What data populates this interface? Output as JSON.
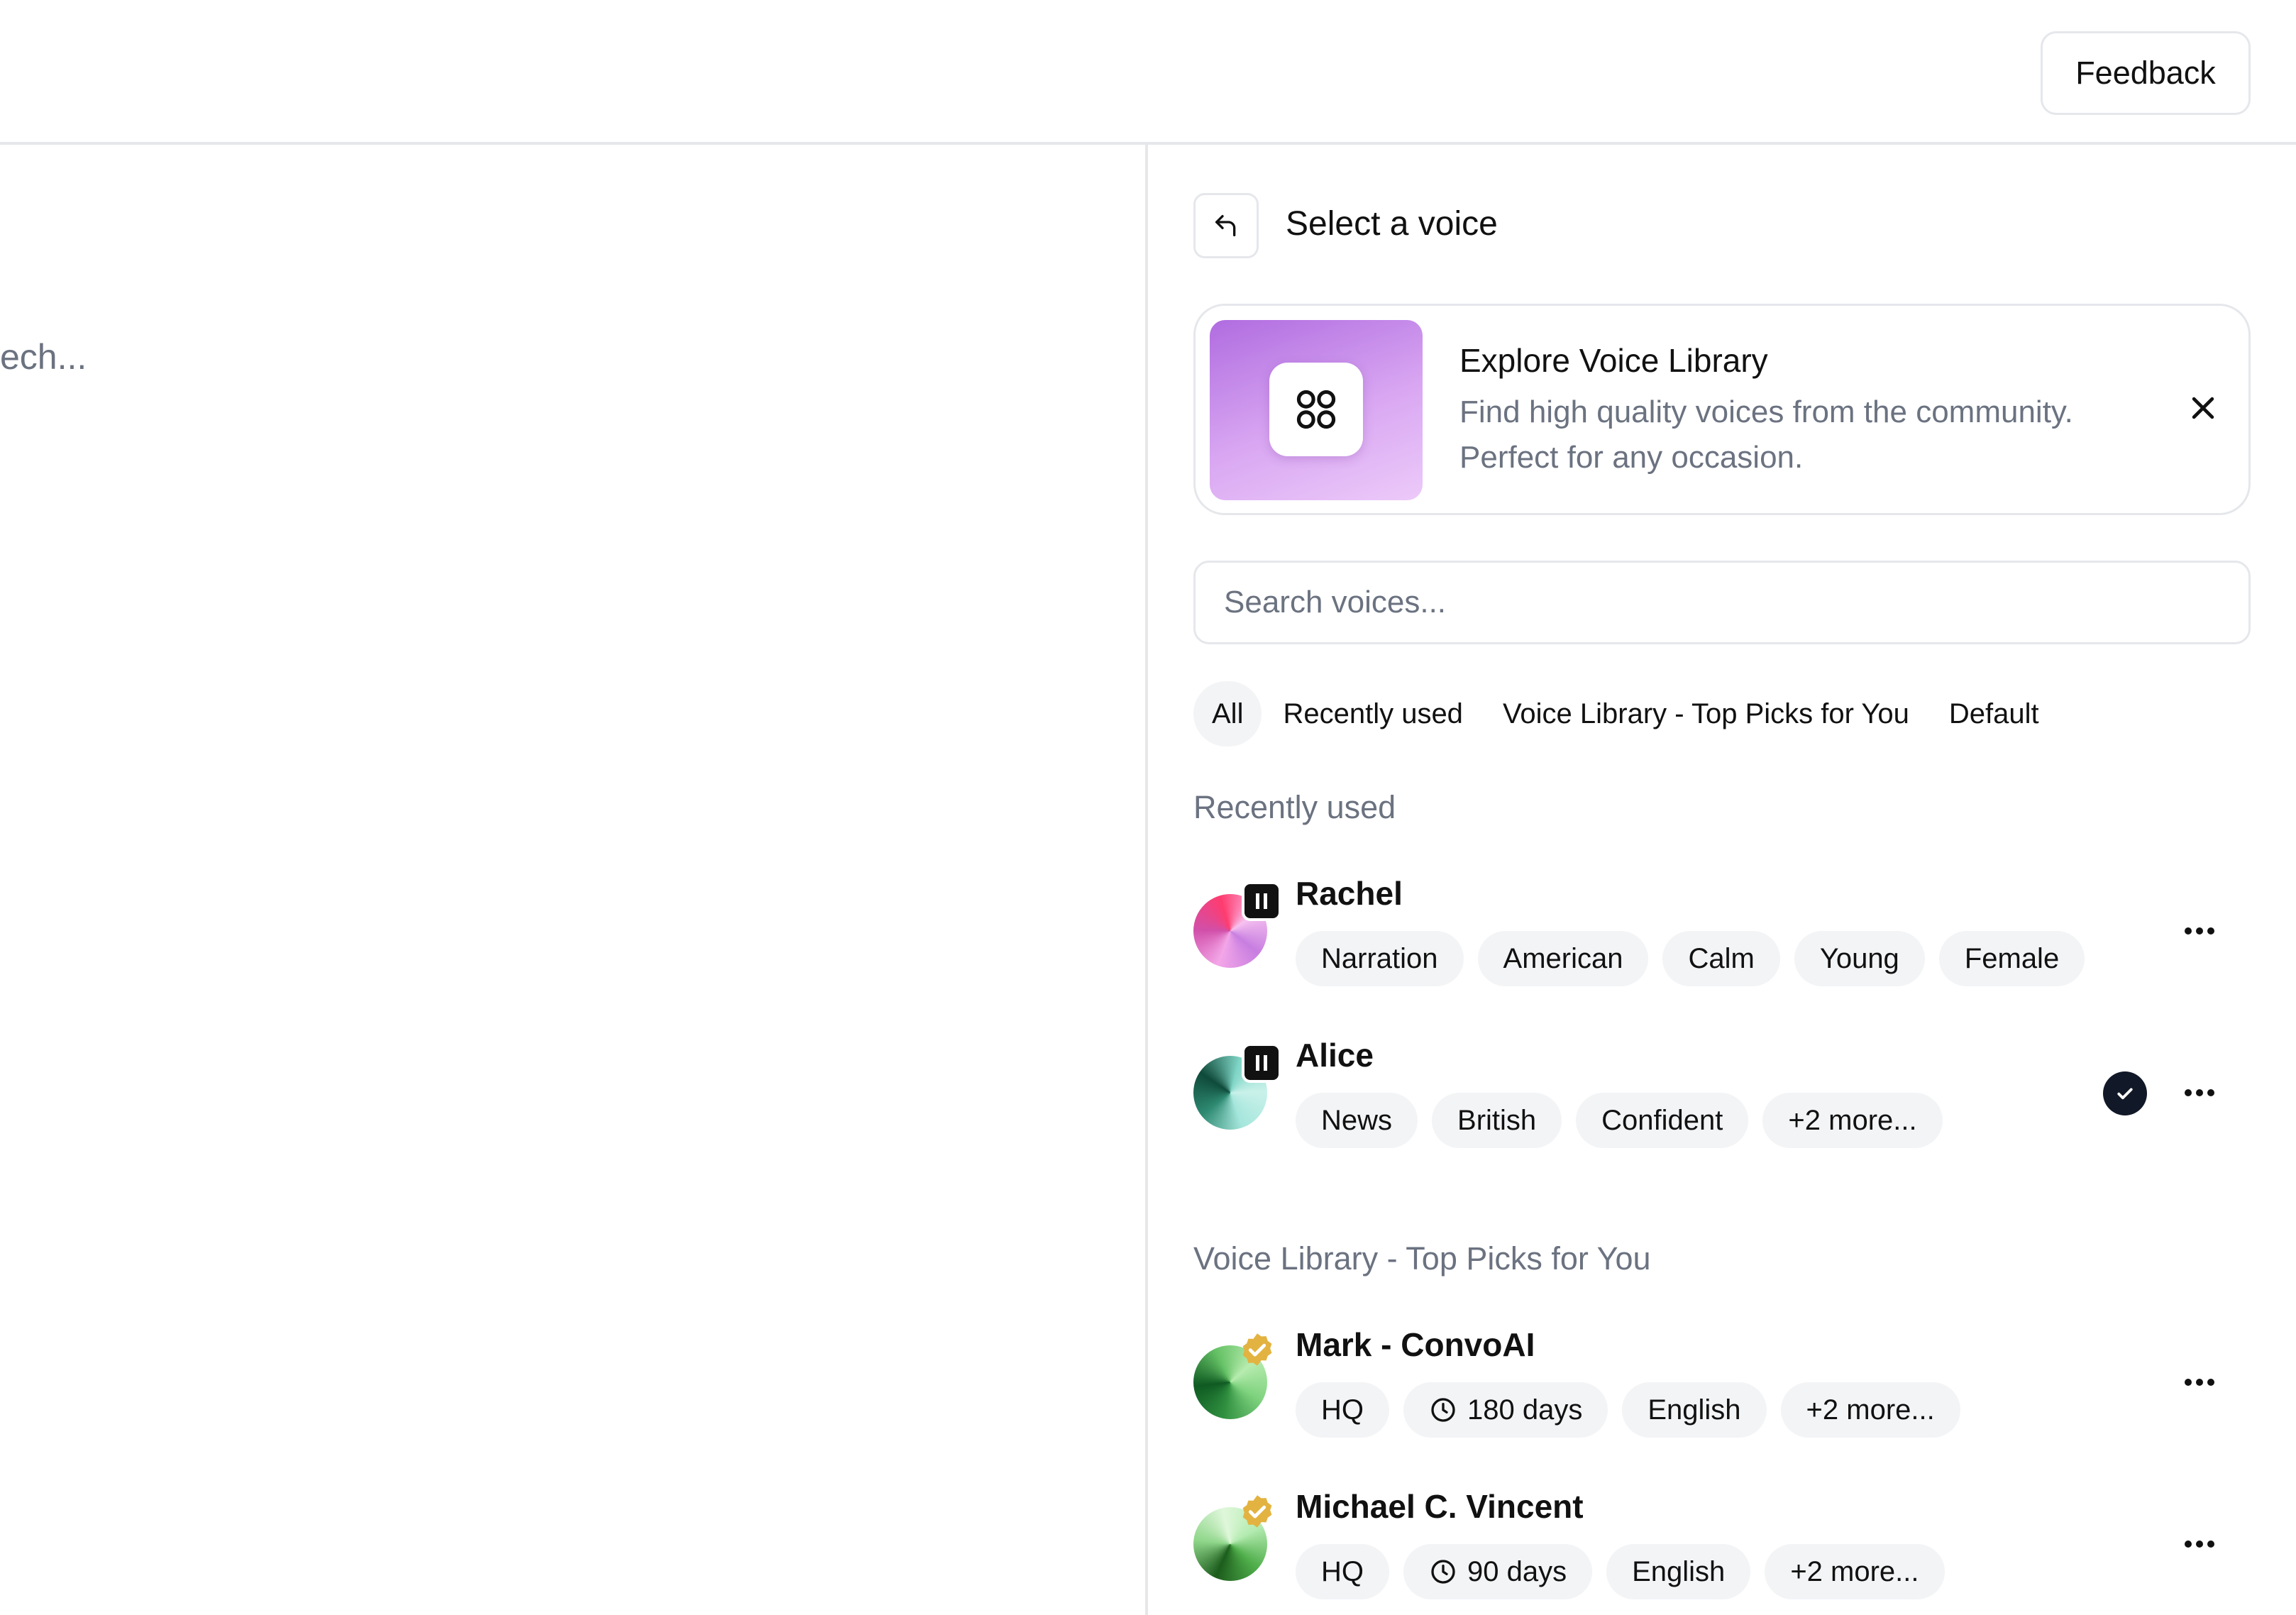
{
  "header": {
    "feedback_label": "Feedback"
  },
  "left_panel": {
    "placeholder_fragment": "ech..."
  },
  "panel": {
    "title": "Select a voice",
    "back_icon": "back-arrow-icon"
  },
  "promo": {
    "title": "Explore Voice Library",
    "description": "Find high quality voices from the community. Perfect for any occasion.",
    "icon": "library-grid-icon",
    "close_icon": "close-icon",
    "thumb_colors": [
      "#b06ce0",
      "#eccaf9"
    ]
  },
  "search": {
    "placeholder": "Search voices...",
    "value": ""
  },
  "filters": [
    {
      "label": "All",
      "active": true
    },
    {
      "label": "Recently used",
      "active": false
    },
    {
      "label": "Voice Library - Top Picks for You",
      "active": false
    },
    {
      "label": "Default",
      "active": false
    }
  ],
  "sections": {
    "recent": {
      "label": "Recently used",
      "voices": [
        {
          "name": "Rachel",
          "tags": [
            "Narration",
            "American",
            "Calm",
            "Young",
            "Female"
          ],
          "badge": "pause-icon",
          "selected": false
        },
        {
          "name": "Alice",
          "tags": [
            "News",
            "British",
            "Confident",
            "+2 more..."
          ],
          "badge": "pause-icon",
          "selected": true
        }
      ]
    },
    "library": {
      "label": "Voice Library - Top Picks for You",
      "voices": [
        {
          "name": "Mark - ConvoAI",
          "tags": [
            "HQ",
            "180 days",
            "English",
            "+2 more..."
          ],
          "badge": "verified-icon"
        },
        {
          "name": "Michael C. Vincent",
          "tags": [
            "HQ",
            "90 days",
            "English",
            "+2 more..."
          ],
          "badge": "verified-icon"
        }
      ]
    }
  },
  "colors": {
    "muted_text": "#6b7280",
    "border": "#e5e7eb",
    "tag_bg": "#f3f4f6",
    "verified_gold": "#e3b341",
    "check_dark": "#111827"
  }
}
